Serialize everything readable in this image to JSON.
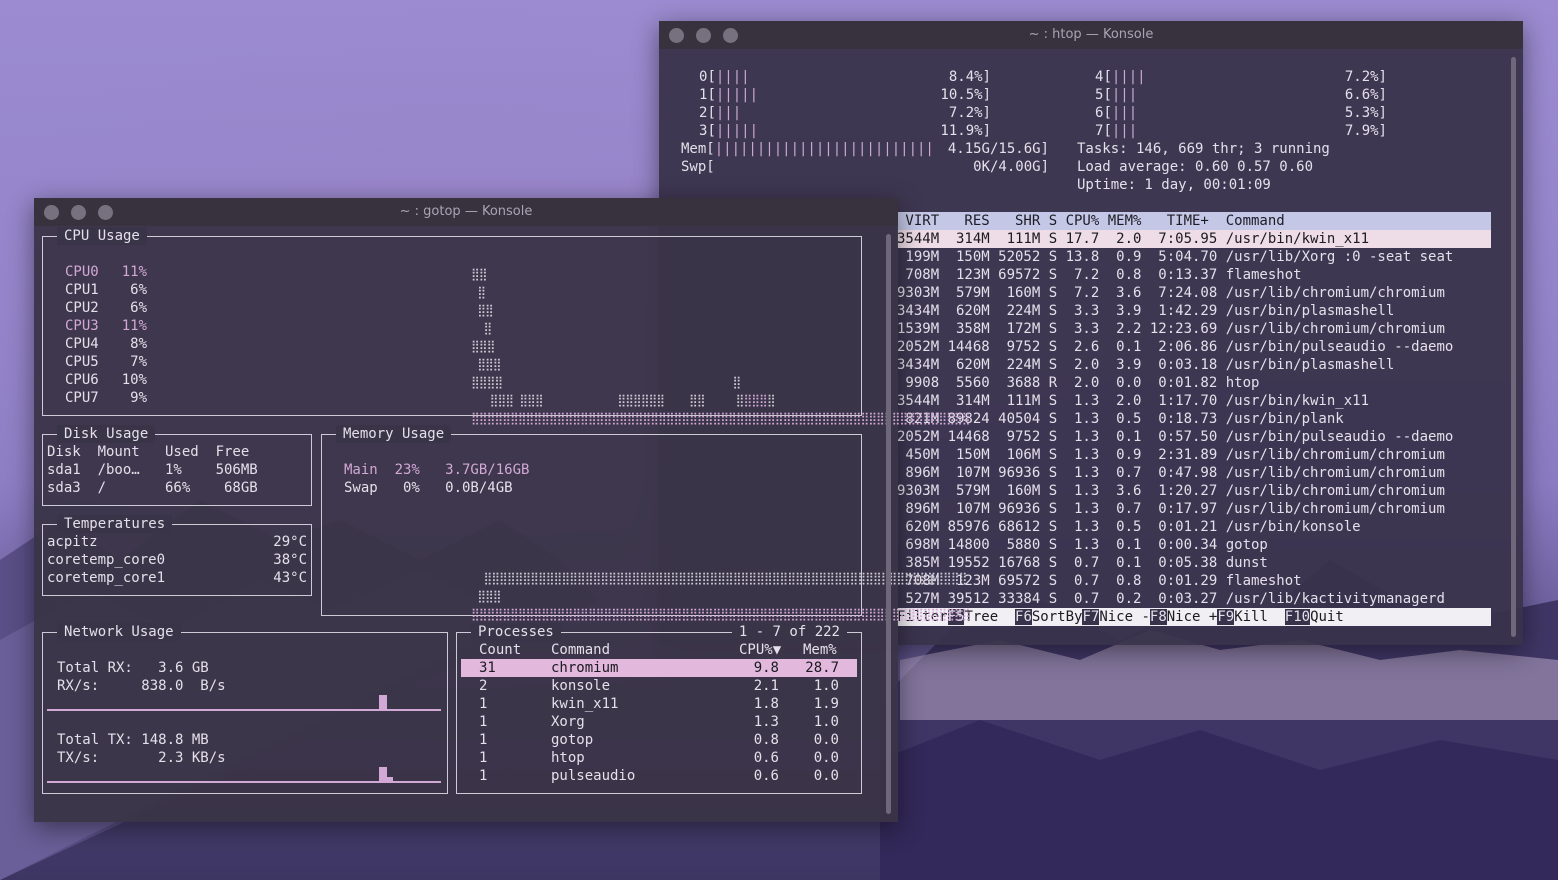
{
  "htop": {
    "title": "~ : htop — Konsole",
    "cpus_left": [
      {
        "id": "0",
        "bars": "||||",
        "pct": "8.4%]"
      },
      {
        "id": "1",
        "bars": "|||||",
        "pct": "10.5%]"
      },
      {
        "id": "2",
        "bars": "|||",
        "pct": "7.2%]"
      },
      {
        "id": "3",
        "bars": "|||||",
        "pct": "11.9%]"
      }
    ],
    "cpus_right": [
      {
        "id": "4",
        "bars": "||||",
        "pct": "7.2%]"
      },
      {
        "id": "5",
        "bars": "|||",
        "pct": "6.6%]"
      },
      {
        "id": "6",
        "bars": "|||",
        "pct": "5.3%]"
      },
      {
        "id": "7",
        "bars": "|||",
        "pct": "7.9%]"
      }
    ],
    "mem_label": "Mem[",
    "mem_bars": "||||||||||||||||||||||||||",
    "mem_value": "4.15G/15.6G]",
    "swp_label": "Swp[",
    "swp_value": "0K/4.00G]",
    "tasks": "Tasks: 146, 669 thr; 3 running",
    "load": "Load average: 0.60 0.57 0.60",
    "uptime": "Uptime: 1 day, 00:01:09",
    "header": " VIRT   RES   SHR S CPU% MEM%   TIME+  Command",
    "rows": [
      "3544M  314M  111M S 17.7  2.0  7:05.95 /usr/bin/kwin_x11",
      " 199M  150M 52052 S 13.8  0.9  5:04.70 /usr/lib/Xorg :0 -seat seat",
      " 708M  123M 69572 S  7.2  0.8  0:13.37 flameshot",
      "9303M  579M  160M S  7.2  3.6  7:24.08 /usr/lib/chromium/chromium",
      "3434M  620M  224M S  3.3  3.9  1:42.29 /usr/bin/plasmashell",
      "1539M  358M  172M S  3.3  2.2 12:23.69 /usr/lib/chromium/chromium",
      "2052M 14468  9752 S  2.6  0.1  2:06.86 /usr/bin/pulseaudio --daemo",
      "3434M  620M  224M S  2.0  3.9  0:03.18 /usr/bin/plasmashell",
      " 9908  5560  3688 R  2.0  0.0  0:01.82 htop",
      "3544M  314M  111M S  1.3  2.0  1:17.70 /usr/bin/kwin_x11",
      " 821M 89824 40504 S  1.3  0.5  0:18.73 /usr/bin/plank",
      "2052M 14468  9752 S  1.3  0.1  0:57.50 /usr/bin/pulseaudio --daemo",
      " 450M  150M  106M S  1.3  0.9  2:31.89 /usr/lib/chromium/chromium",
      " 896M  107M 96936 S  1.3  0.7  0:47.98 /usr/lib/chromium/chromium",
      "9303M  579M  160M S  1.3  3.6  1:20.27 /usr/lib/chromium/chromium",
      " 896M  107M 96936 S  1.3  0.7  0:17.97 /usr/lib/chromium/chromium",
      " 620M 85976 68612 S  1.3  0.5  0:01.21 /usr/bin/konsole",
      " 698M 14800  5880 S  1.3  0.1  0:00.34 gotop",
      " 385M 19552 16768 S  0.7  0.1  0:05.38 dunst",
      " 708M  123M 69572 S  0.7  0.8  0:01.29 flameshot",
      " 527M 39512 33384 S  0.7  0.2  0:03.27 /usr/lib/kactivitymanagerd"
    ],
    "fkeys": [
      {
        "key": "",
        "label": "Filter"
      },
      {
        "key": "F5",
        "label": "Tree  "
      },
      {
        "key": "F6",
        "label": "SortBy"
      },
      {
        "key": "F7",
        "label": "Nice -"
      },
      {
        "key": "F8",
        "label": "Nice +"
      },
      {
        "key": "F9",
        "label": "Kill  "
      },
      {
        "key": "F10",
        "label": "Quit"
      }
    ]
  },
  "gotop": {
    "title": "~ : gotop — Konsole",
    "cpu": {
      "title": "CPU Usage",
      "cores": [
        {
          "name": "CPU0",
          "pct": "11%",
          "pink": true
        },
        {
          "name": "CPU1",
          "pct": "6%",
          "pink": false
        },
        {
          "name": "CPU2",
          "pct": "6%",
          "pink": false
        },
        {
          "name": "CPU3",
          "pct": "11%",
          "pink": true
        },
        {
          "name": "CPU4",
          "pct": "8%",
          "pink": false
        },
        {
          "name": "CPU5",
          "pct": "7%",
          "pink": false
        },
        {
          "name": "CPU6",
          "pct": "10%",
          "pink": false
        },
        {
          "name": "CPU7",
          "pct": "9%",
          "pink": false
        }
      ]
    },
    "disk": {
      "title": "Disk Usage",
      "header": "Disk  Mount   Used  Free",
      "rows": [
        "sda1  /boo…   1%    506MB",
        "sda3  /       66%    68GB"
      ]
    },
    "memory": {
      "title": "Memory Usage",
      "main": "Main  23%   3.7GB/16GB",
      "swap": "Swap   0%   0.0B/4GB"
    },
    "temps": {
      "title": "Temperatures",
      "rows": [
        {
          "name": "acpitz",
          "val": "29°C"
        },
        {
          "name": "coretemp_core0",
          "val": "38°C"
        },
        {
          "name": "coretemp_core1",
          "val": "43°C"
        }
      ]
    },
    "network": {
      "title": "Network Usage",
      "rx_total": "Total RX:   3.6 GB",
      "rx_rate": "RX/s:     838.0  B/s",
      "tx_total": "Total TX: 148.8 MB",
      "tx_rate": "TX/s:       2.3 KB/s"
    },
    "processes": {
      "title": "Processes",
      "range": "1 - 7 of 222",
      "headers": {
        "count": "Count",
        "command": "Command",
        "cpu": "CPU%▼",
        "mem": "Mem%"
      },
      "rows": [
        {
          "count": "31",
          "command": "chromium",
          "cpu": "9.8",
          "mem": "28.7"
        },
        {
          "count": "2",
          "command": "konsole",
          "cpu": "2.1",
          "mem": "1.0"
        },
        {
          "count": "1",
          "command": "kwin_x11",
          "cpu": "1.8",
          "mem": "1.9"
        },
        {
          "count": "1",
          "command": "Xorg",
          "cpu": "1.3",
          "mem": "1.0"
        },
        {
          "count": "1",
          "command": "gotop",
          "cpu": "0.8",
          "mem": "0.0"
        },
        {
          "count": "1",
          "command": "htop",
          "cpu": "0.6",
          "mem": "0.0"
        },
        {
          "count": "1",
          "command": "pulseaudio",
          "cpu": "0.6",
          "mem": "0.0"
        }
      ]
    }
  }
}
